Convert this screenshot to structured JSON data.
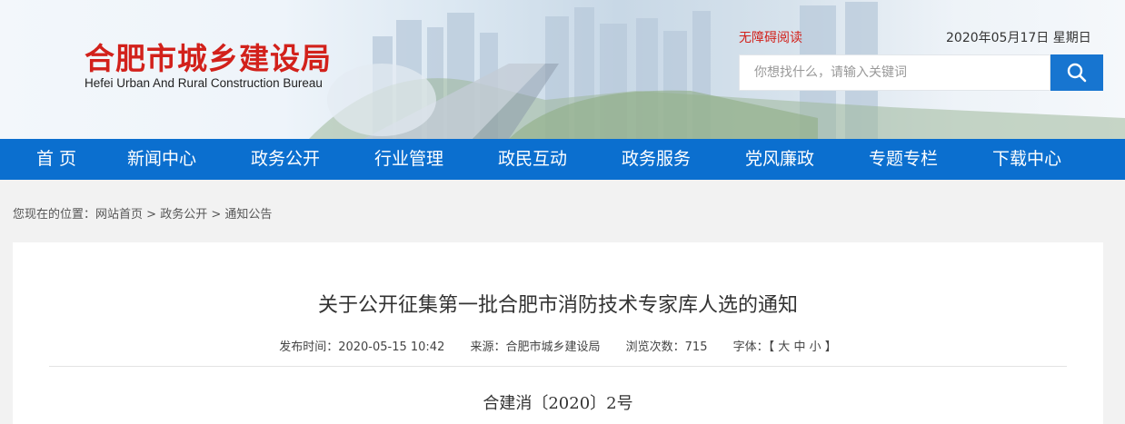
{
  "site": {
    "name_cn": "合肥市城乡建设局",
    "name_en": "Hefei Urban And Rural Construction Bureau",
    "accessible_label": "无障碍阅读",
    "date": "2020年05月17日 星期日"
  },
  "search": {
    "placeholder": "你想找什么，请输入关键词"
  },
  "nav": {
    "items": [
      "首 页",
      "新闻中心",
      "政务公开",
      "行业管理",
      "政民互动",
      "政务服务",
      "党风廉政",
      "专题专栏",
      "下载中心"
    ]
  },
  "breadcrumb": {
    "prefix": "您现在的位置：",
    "items": [
      "网站首页",
      "政务公开",
      "通知公告"
    ],
    "separator": " > "
  },
  "article": {
    "title": "关于公开征集第一批合肥市消防技术专家库人选的通知",
    "publish_label": "发布时间：2020-05-15 10:42",
    "source_label": "来源：合肥市城乡建设局",
    "views_label": "浏览次数：715",
    "font_label": "字体：",
    "font_open": "【",
    "font_large": "大",
    "font_medium": "中",
    "font_small": "小",
    "font_close": "】",
    "doc_number": "合建消〔2020〕2号"
  },
  "colors": {
    "brand_red": "#d2211b",
    "nav_blue": "#0b6fcf",
    "search_btn": "#1775d0"
  }
}
